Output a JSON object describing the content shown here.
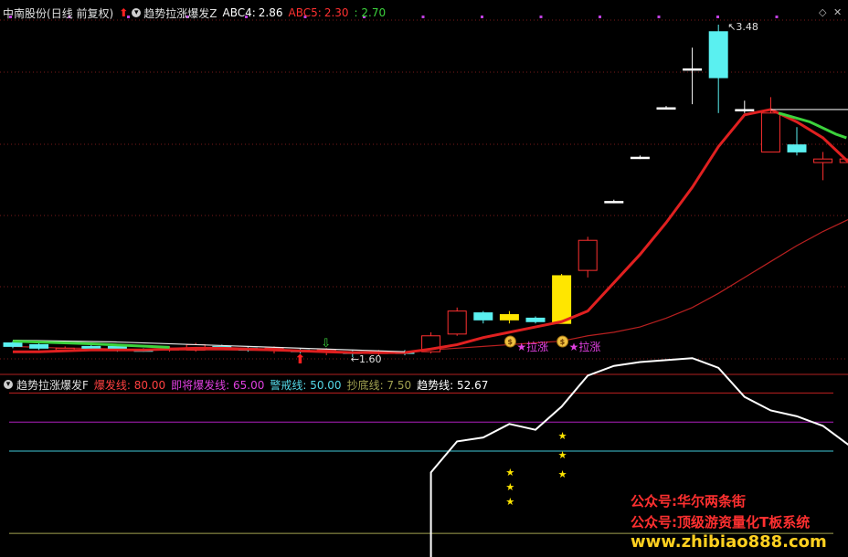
{
  "main_panel": {
    "stock_name": "中南股份",
    "period": "(日线 前复权)",
    "indicator_name": "趋势拉涨爆发Z",
    "abc4_label": "ABC4:",
    "abc4_value": "2.86",
    "abc5_label": "ABC5:",
    "abc5_value": "2.30",
    "abc5_extra": ": 2.70",
    "high_label": "3.48",
    "low_label": "1.60",
    "signal_text": "★拉涨",
    "colors": {
      "title": "#e0e0e0",
      "abc4": "#ffffff",
      "abc5": "#ff3030",
      "abc5_extra": "#3cd23c"
    }
  },
  "sub_panel": {
    "indicator_name": "趋势拉涨爆发F",
    "lines": [
      {
        "label": "爆发线:",
        "value": "80.00",
        "color": "#ff4040"
      },
      {
        "label": "即将爆发线:",
        "value": "65.00",
        "color": "#e040e0"
      },
      {
        "label": "警戒线:",
        "value": "50.00",
        "color": "#55d8e8"
      },
      {
        "label": "抄底线:",
        "value": "7.50",
        "color": "#a0a050"
      },
      {
        "label": "趋势线:",
        "value": "52.67",
        "color": "#ffffff"
      }
    ]
  },
  "watermark": {
    "line1": "公众号:华尔两条街",
    "line2": "公众号:顶级游资量化T板系统",
    "line3": "www.zhibiao888.com",
    "colors": [
      "#ff3030",
      "#ff3030",
      "#ffd020"
    ]
  },
  "chart_data": [
    {
      "type": "candlestick",
      "title": "趋势拉涨爆发Z",
      "price_high_label": 3.48,
      "price_low_label": 1.6,
      "candles": [
        {
          "o": 1.68,
          "c": 1.66,
          "h": 1.69,
          "l": 1.65,
          "color": "cyan"
        },
        {
          "o": 1.67,
          "c": 1.65,
          "h": 1.68,
          "l": 1.64,
          "color": "cyan"
        },
        {
          "o": 1.64,
          "c": 1.65,
          "h": 1.66,
          "l": 1.63,
          "color": "red"
        },
        {
          "o": 1.66,
          "c": 1.65,
          "h": 1.67,
          "l": 1.64,
          "color": "cyan"
        },
        {
          "o": 1.66,
          "c": 1.64,
          "h": 1.67,
          "l": 1.63,
          "color": "cyan"
        },
        {
          "o": 1.64,
          "c": 1.64,
          "h": 1.65,
          "l": 1.63,
          "color": "cyan"
        },
        {
          "o": 1.64,
          "c": 1.65,
          "h": 1.66,
          "l": 1.63,
          "color": "red"
        },
        {
          "o": 1.64,
          "c": 1.67,
          "h": 1.68,
          "l": 1.63,
          "color": "red"
        },
        {
          "o": 1.66,
          "c": 1.66,
          "h": 1.67,
          "l": 1.65,
          "color": "cyan"
        },
        {
          "o": 1.65,
          "c": 1.64,
          "h": 1.66,
          "l": 1.63,
          "color": "cyan"
        },
        {
          "o": 1.64,
          "c": 1.65,
          "h": 1.66,
          "l": 1.62,
          "color": "red"
        },
        {
          "o": 1.64,
          "c": 1.63,
          "h": 1.65,
          "l": 1.62,
          "color": "cyan"
        },
        {
          "o": 1.63,
          "c": 1.64,
          "h": 1.65,
          "l": 1.61,
          "color": "red"
        },
        {
          "o": 1.63,
          "c": 1.62,
          "h": 1.64,
          "l": 1.6,
          "color": "cyan"
        },
        {
          "o": 1.62,
          "c": 1.63,
          "h": 1.64,
          "l": 1.61,
          "color": "red"
        },
        {
          "o": 1.63,
          "c": 1.62,
          "h": 1.64,
          "l": 1.61,
          "color": "cyan"
        },
        {
          "o": 1.63,
          "c": 1.72,
          "h": 1.74,
          "l": 1.62,
          "color": "red"
        },
        {
          "o": 1.73,
          "c": 1.86,
          "h": 1.88,
          "l": 1.72,
          "color": "red"
        },
        {
          "o": 1.85,
          "c": 1.81,
          "h": 1.86,
          "l": 1.79,
          "color": "cyan"
        },
        {
          "o": 1.84,
          "c": 1.81,
          "h": 1.86,
          "l": 1.79,
          "color": "yellow"
        },
        {
          "o": 1.82,
          "c": 1.8,
          "h": 1.83,
          "l": 1.79,
          "color": "cyan"
        },
        {
          "o": 1.79,
          "c": 2.06,
          "h": 2.07,
          "l": 1.79,
          "color": "yellow"
        },
        {
          "o": 2.09,
          "c": 2.26,
          "h": 2.28,
          "l": 2.05,
          "color": "red"
        },
        {
          "o": 2.48,
          "c": 2.48,
          "h": 2.49,
          "l": 2.47,
          "color": "white"
        },
        {
          "o": 2.73,
          "c": 2.73,
          "h": 2.74,
          "l": 2.72,
          "color": "white"
        },
        {
          "o": 3.01,
          "c": 3.01,
          "h": 3.02,
          "l": 3.0,
          "color": "white"
        },
        {
          "o": 3.23,
          "c": 3.23,
          "h": 3.35,
          "l": 3.03,
          "color": "white"
        },
        {
          "o": 3.44,
          "c": 3.18,
          "h": 3.48,
          "l": 2.98,
          "color": "cyan"
        },
        {
          "o": 3.0,
          "c": 3.0,
          "h": 3.05,
          "l": 2.98,
          "color": "white"
        },
        {
          "o": 2.98,
          "c": 2.76,
          "h": 3.07,
          "l": 2.76,
          "color": "red"
        },
        {
          "o": 2.8,
          "c": 2.76,
          "h": 2.9,
          "l": 2.74,
          "color": "cyan"
        },
        {
          "o": 2.72,
          "c": 2.7,
          "h": 2.76,
          "l": 2.6,
          "color": "red"
        },
        {
          "o": 2.72,
          "c": 2.7,
          "h": 2.8,
          "l": 2.64,
          "color": "red"
        }
      ],
      "trend_line": [
        1.63,
        1.63,
        1.635,
        1.64,
        1.64,
        1.64,
        1.645,
        1.65,
        1.65,
        1.645,
        1.64,
        1.635,
        1.63,
        1.625,
        1.625,
        1.625,
        1.645,
        1.67,
        1.71,
        1.74,
        1.77,
        1.8,
        1.86,
        2.02,
        2.18,
        2.36,
        2.56,
        2.79,
        2.97,
        3.0,
        2.93,
        2.84,
        2.7
      ],
      "slow_line": [
        1.66,
        1.655,
        1.65,
        1.65,
        1.645,
        1.64,
        1.64,
        1.64,
        1.64,
        1.638,
        1.636,
        1.634,
        1.632,
        1.63,
        1.63,
        1.63,
        1.64,
        1.65,
        1.66,
        1.67,
        1.68,
        1.69,
        1.72,
        1.74,
        1.77,
        1.82,
        1.88,
        1.96,
        2.05,
        2.14,
        2.23,
        2.31,
        2.38
      ]
    },
    {
      "type": "line",
      "title": "趋势拉涨爆发F",
      "reference_lines": [
        80,
        65,
        50,
        7.5
      ],
      "series": [
        {
          "name": "趋势线",
          "values": [
            null,
            null,
            null,
            null,
            null,
            null,
            null,
            null,
            null,
            null,
            null,
            null,
            null,
            null,
            null,
            null,
            39,
            55,
            57,
            64,
            61,
            73,
            89,
            94,
            96,
            97,
            98,
            93,
            78,
            71,
            68,
            63,
            53
          ]
        }
      ],
      "last_value": 52.67
    }
  ]
}
